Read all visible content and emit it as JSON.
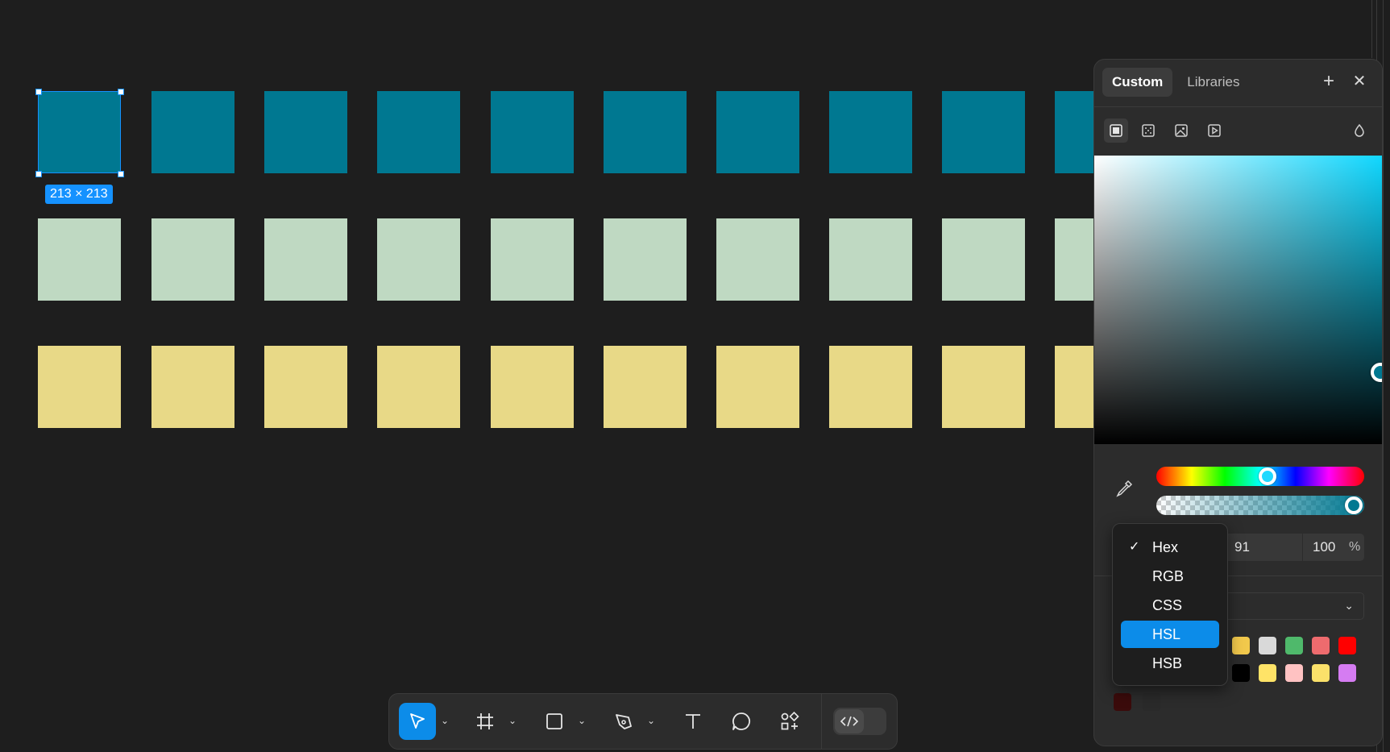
{
  "canvas": {
    "selection_badge": "213 × 213",
    "row_colors": [
      "#007891",
      "#bfd9c2",
      "#e8d987"
    ]
  },
  "panel": {
    "tabs": [
      {
        "label": "Custom",
        "active": true
      },
      {
        "label": "Libraries",
        "active": false
      }
    ],
    "add_icon": "+",
    "close_icon": "✕",
    "fill_types": [
      "solid-fill-icon",
      "gradient-fill-icon",
      "image-fill-icon",
      "video-fill-icon"
    ],
    "blend_icon": "drop-icon",
    "hex_value_partial": "91",
    "alpha_value": "100",
    "alpha_unit": "%",
    "base_color": "#0fd7ff",
    "selected_color": "#007891",
    "swatches_row1": [
      "#f2c94c",
      "#d9d9d9",
      "#4fb96b",
      "#ee6b6e",
      "#ff0000"
    ],
    "swatches_row2": [
      "#000000",
      "#ffe367",
      "#ffc2c2",
      "#fbe16a",
      "#d57cf2"
    ],
    "swatches_row3": [
      "#3b0b0b",
      "#2a2a2a"
    ]
  },
  "format_menu": {
    "items": [
      {
        "label": "Hex",
        "checked": true
      },
      {
        "label": "RGB",
        "checked": false
      },
      {
        "label": "CSS",
        "checked": false
      },
      {
        "label": "HSL",
        "highlighted": true
      },
      {
        "label": "HSB",
        "checked": false
      }
    ],
    "check_mark": "✓"
  },
  "toolbar": {
    "tools": [
      "move-tool",
      "frame-tool",
      "shape-tool",
      "pen-tool",
      "text-tool",
      "comment-tool",
      "actions-tool",
      "dev-mode-toggle"
    ],
    "accent": "#0c8ce9"
  }
}
